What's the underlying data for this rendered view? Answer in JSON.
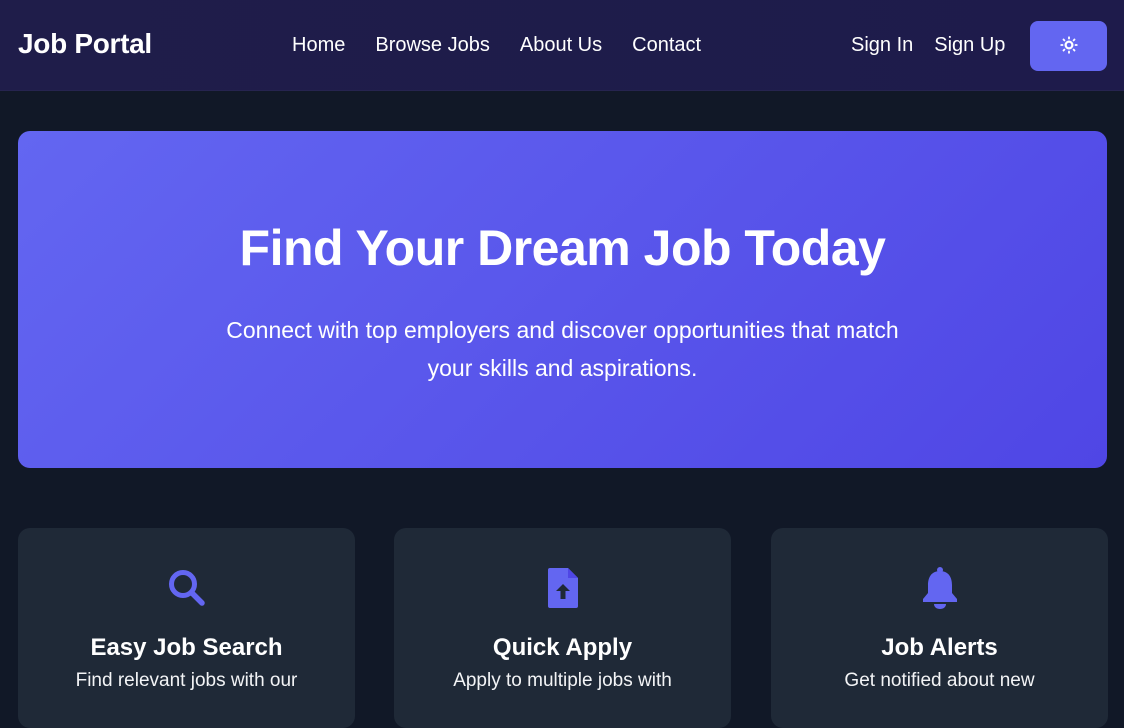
{
  "nav": {
    "brand": "Job Portal",
    "links": [
      "Home",
      "Browse Jobs",
      "About Us",
      "Contact"
    ],
    "sign_in": "Sign In",
    "sign_up": "Sign Up",
    "theme_icon": "sun-icon"
  },
  "hero": {
    "title": "Find Your Dream Job Today",
    "subtitle": "Connect with top employers and discover opportunities that match your skills and aspirations."
  },
  "features": [
    {
      "icon": "search-icon",
      "title": "Easy Job Search",
      "text": "Find relevant jobs with our"
    },
    {
      "icon": "file-upload-icon",
      "title": "Quick Apply",
      "text": "Apply to multiple jobs with"
    },
    {
      "icon": "bell-icon",
      "title": "Job Alerts",
      "text": "Get notified about new"
    }
  ],
  "colors": {
    "nav_bg": "#1e1b4b",
    "page_bg": "#111827",
    "accent": "#6366f1",
    "card_bg": "#1f2937"
  }
}
